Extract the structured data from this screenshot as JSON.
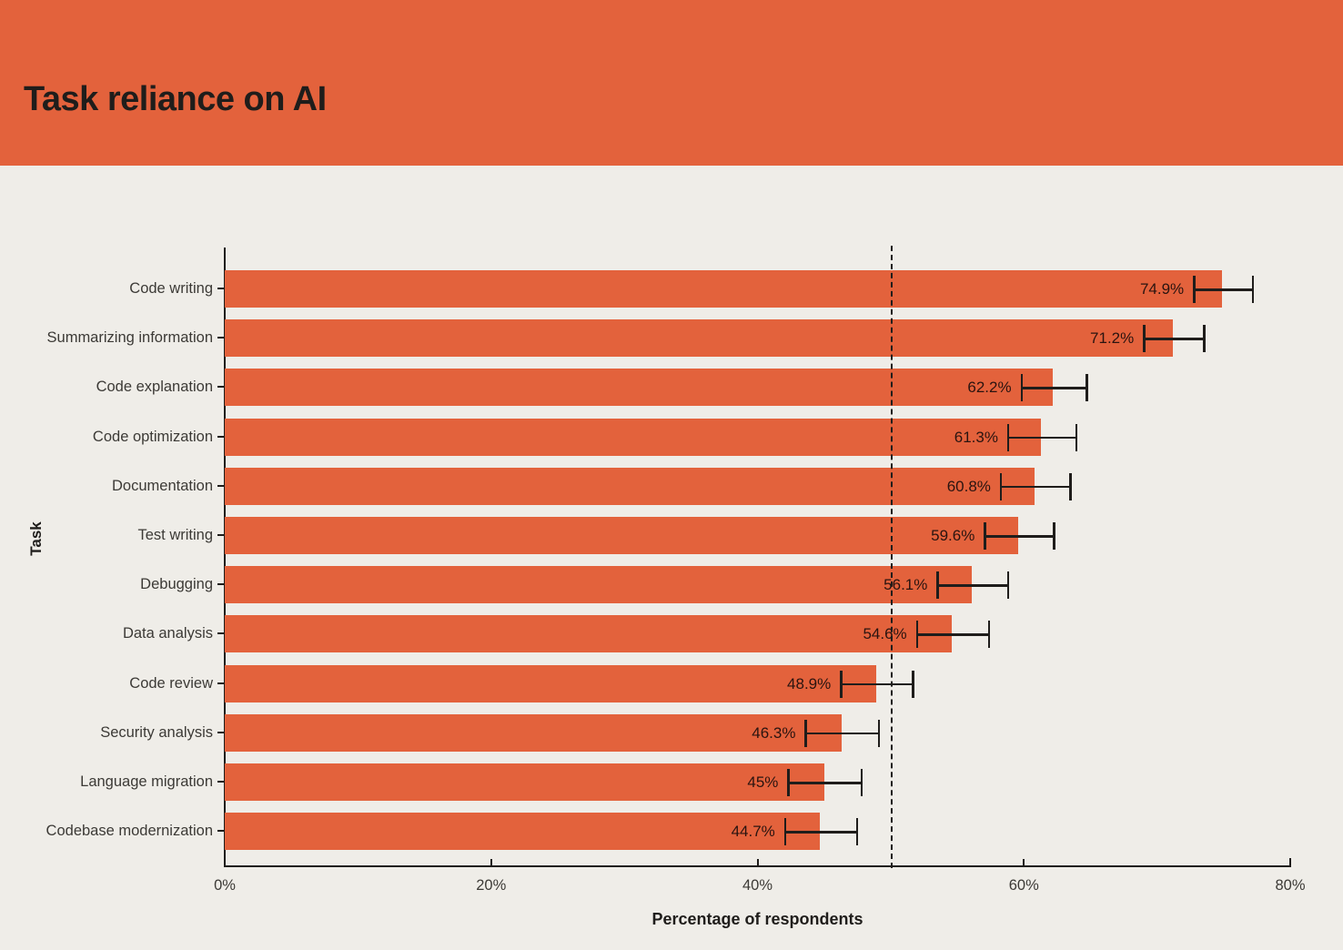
{
  "header": {
    "title": "Task reliance on AI",
    "background_color": "#e3623c"
  },
  "colors": {
    "page_background": "#efede8",
    "accent": "#e3623c",
    "ink": "#1f1d1b",
    "axis_text": "#3c3a36"
  },
  "chart_data": {
    "type": "bar",
    "orientation": "horizontal",
    "title": "Task reliance on AI",
    "xlabel": "Percentage of respondents",
    "ylabel": "Task",
    "xlim": [
      0,
      80
    ],
    "xtick_labels": [
      "0%",
      "20%",
      "40%",
      "60%",
      "80%"
    ],
    "xticks": [
      0,
      20,
      40,
      60,
      80
    ],
    "grid": false,
    "legend": "none",
    "reference_line": {
      "value": 50,
      "style": "dashed",
      "color": "#1f1d1b"
    },
    "error_bars": "95% confidence interval",
    "categories": [
      "Code writing",
      "Summarizing information",
      "Code explanation",
      "Code optimization",
      "Documentation",
      "Test writing",
      "Debugging",
      "Data analysis",
      "Code review",
      "Security analysis",
      "Language migration",
      "Codebase modernization"
    ],
    "values": [
      74.9,
      71.2,
      62.2,
      61.3,
      60.8,
      59.6,
      56.1,
      54.6,
      48.9,
      46.3,
      45,
      44.7
    ],
    "value_labels": [
      "74.9%",
      "71.2%",
      "62.2%",
      "61.3%",
      "60.8%",
      "59.6%",
      "56.1%",
      "54.6%",
      "48.9%",
      "46.3%",
      "45%",
      "44.7%"
    ],
    "errors": [
      2.2,
      2.25,
      2.45,
      2.55,
      2.6,
      2.6,
      2.65,
      2.7,
      2.7,
      2.75,
      2.75,
      2.7
    ]
  }
}
